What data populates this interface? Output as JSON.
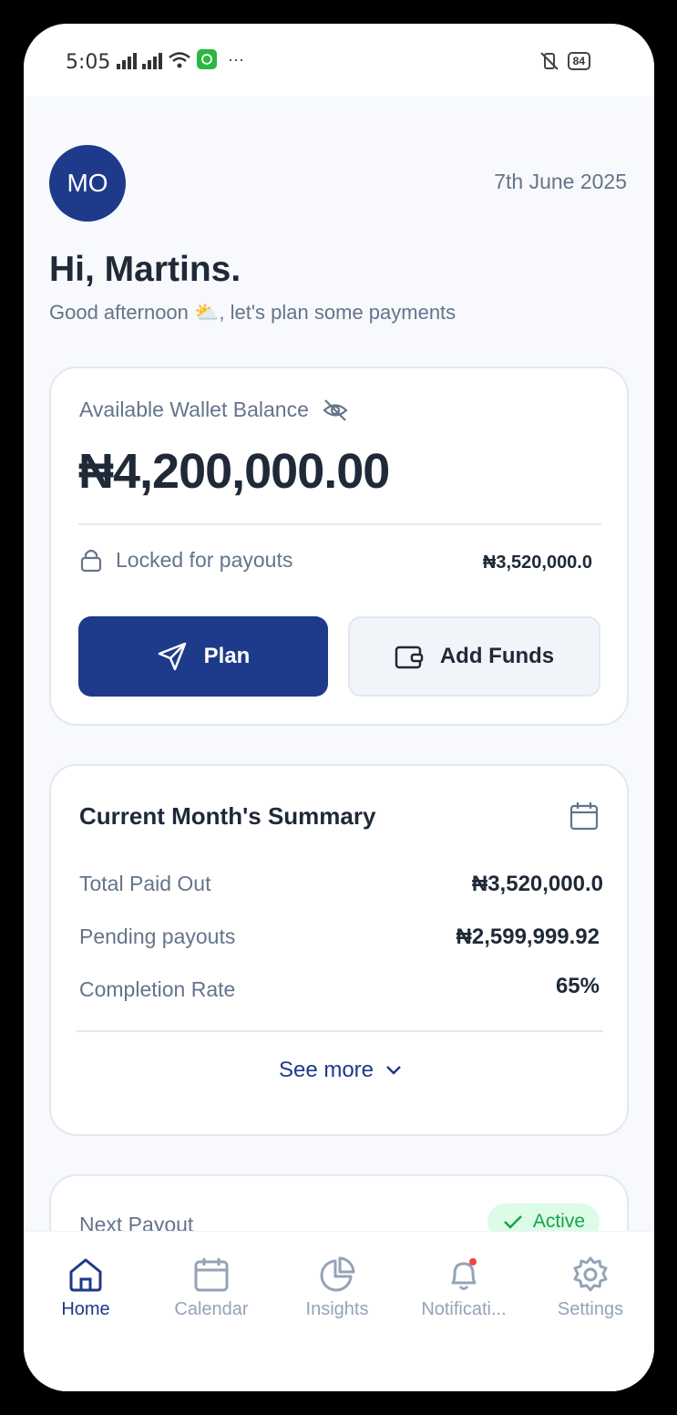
{
  "status_bar": {
    "time": "5:05",
    "battery": "84"
  },
  "header": {
    "avatar_initials": "MO",
    "date": "7th June 2025"
  },
  "greeting": {
    "title": "Hi, Martins.",
    "subtitle": "Good afternoon ⛅, let's plan some payments"
  },
  "wallet": {
    "label": "Available Wallet Balance",
    "amount": "₦4,200,000.00",
    "locked_label": "Locked for payouts",
    "locked_value": "₦3,520,000.0",
    "plan_label": "Plan",
    "add_funds_label": "Add Funds"
  },
  "summary": {
    "title": "Current Month's Summary",
    "rows": [
      {
        "label": "Total Paid Out",
        "value": "₦3,520,000.0"
      },
      {
        "label": "Pending payouts",
        "value": "₦2,599,999.92"
      },
      {
        "label": "Completion Rate",
        "value": "65%"
      }
    ],
    "see_more": "See more"
  },
  "next_payout": {
    "label": "Next Payout",
    "status": "Active"
  },
  "nav": {
    "items": [
      {
        "label": "Home",
        "icon": "home-icon",
        "active": true
      },
      {
        "label": "Calendar",
        "icon": "calendar-icon"
      },
      {
        "label": "Insights",
        "icon": "pie-chart-icon"
      },
      {
        "label": "Notificati...",
        "icon": "bell-icon"
      },
      {
        "label": "Settings",
        "icon": "gear-icon"
      }
    ]
  },
  "colors": {
    "primary": "#1e3a8a",
    "muted": "#64748b",
    "success": "#16a34a",
    "badge_bg": "#dcfce7"
  }
}
